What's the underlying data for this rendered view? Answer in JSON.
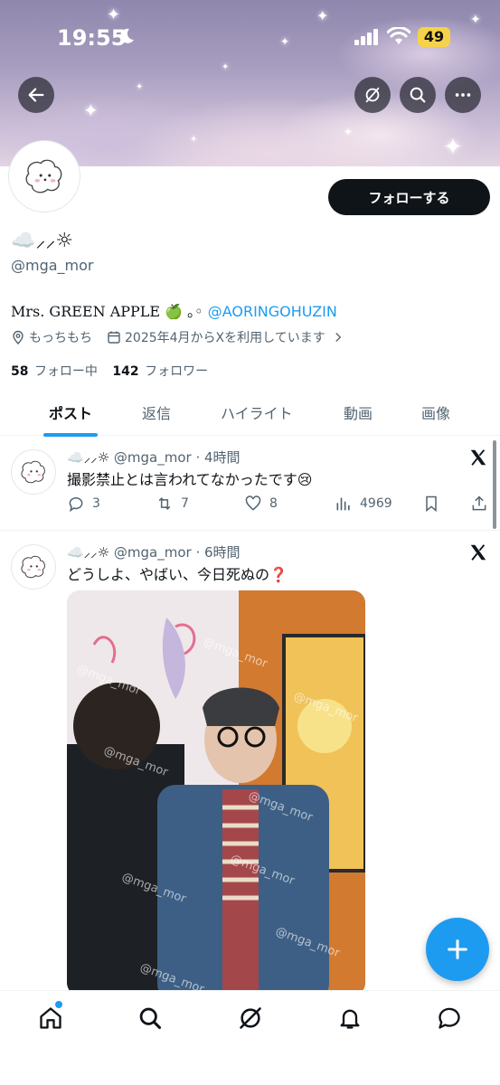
{
  "status_bar": {
    "time": "19:55",
    "battery": "49"
  },
  "profile": {
    "display_name": "☁️⸝⸝☼",
    "handle": "@mga_mor",
    "bio_text": "Mrs. GREEN APPLE 🍏 ｡◦ ",
    "bio_link": "@AORINGOHUZIN",
    "location": "もっちもち",
    "joined": "2025年4月からXを利用しています",
    "following_count": "58",
    "following_label": "フォロー中",
    "followers_count": "142",
    "followers_label": "フォロワー",
    "follow_button": "フォローする"
  },
  "tabs": [
    {
      "label": "ポスト"
    },
    {
      "label": "返信"
    },
    {
      "label": "ハイライト"
    },
    {
      "label": "動画"
    },
    {
      "label": "画像"
    }
  ],
  "posts": [
    {
      "name": "☁️⸝⸝☼",
      "meta": "@mga_mor · 4時間",
      "text": "撮影禁止とは言われてなかったです😢",
      "replies": "3",
      "reposts": "7",
      "likes": "8",
      "views": "4969"
    },
    {
      "name": "☁️⸝⸝☼",
      "meta": "@mga_mor · 6時間",
      "text": "どうしよ、やばい、今日死ぬの❓",
      "watermark": "@mga_mor"
    }
  ],
  "icons": {
    "back": "back-arrow-icon",
    "grok": "grok-icon",
    "search": "search-icon",
    "more": "more-icon",
    "location": "location-icon",
    "calendar": "calendar-icon",
    "x_logo": "x-logo-icon",
    "compose": "plus-icon"
  },
  "colors": {
    "accent": "#1d9bf0",
    "text": "#0f1419",
    "muted": "#536471"
  }
}
